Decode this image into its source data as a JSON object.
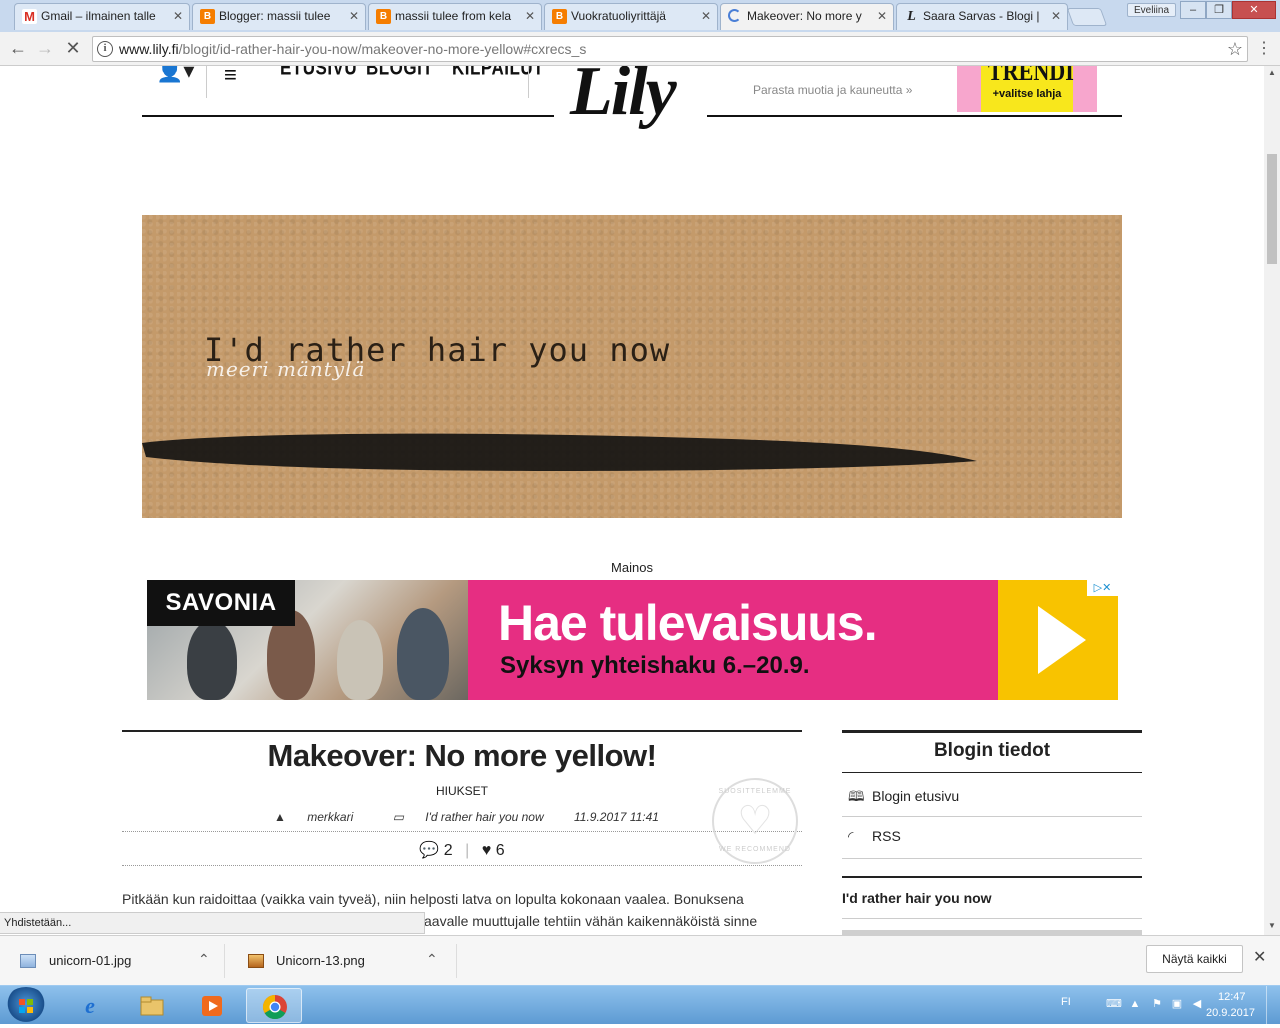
{
  "browser": {
    "tabs": [
      {
        "title": "Gmail – ilmainen talle",
        "favicon": "gmail-icon"
      },
      {
        "title": "Blogger: massii tulee",
        "favicon": "blogger-icon"
      },
      {
        "title": "massii tulee from kela",
        "favicon": "blogger-icon"
      },
      {
        "title": "Vuokratuoliyrittäjä",
        "favicon": "blogger-icon"
      },
      {
        "title": "Makeover: No more y",
        "favicon": "loading-icon",
        "active": true
      },
      {
        "title": "Saara Sarvas - Blogi |",
        "favicon": "lily-icon"
      }
    ],
    "profile_name": "Eveliina",
    "url_host": "www.lily.fi",
    "url_path": "/blogit/id-rather-hair-you-now/makeover-no-more-yellow#cxrecs_s",
    "status_text": "Yhdistetään..."
  },
  "site": {
    "nav": {
      "home": "ETUSIVU",
      "blogs": "BLOGIT",
      "contests": "KILPAILUT"
    },
    "logo": "Lily",
    "promo_text": "Parasta muotia ja kauneutta »",
    "promo_ad": {
      "title": "TRENDI",
      "subtitle": "+valitse lahja"
    }
  },
  "banner": {
    "title": "I'd rather hair you now",
    "subtitle": "meeri mäntylä"
  },
  "ad": {
    "label": "Mainos",
    "brand": "SAVONIA",
    "headline": "Hae tulevaisuus.",
    "subline": "Syksyn yhteishaku 6.–20.9.",
    "choices": "▷✕",
    "colors": {
      "pink": "#e62e82",
      "yellow": "#f8c300"
    }
  },
  "article": {
    "title": "Makeover: No more yellow!",
    "category": "HIUKSET",
    "author": "merkkari",
    "blog": "I'd rather hair you now",
    "date": "11.9.2017 11:41",
    "comments": "2",
    "likes": "6",
    "recommend_top": "SUOSITTELEMME",
    "recommend_bottom": "WE RECOMMEND",
    "body_line1": "Pitkään kun raidoittaa (vaikka vain tyveä), niin helposti latva on lopulta kokonaan vaalea. Bonuksena",
    "body_line2": "aavalle muuttujalle tehtiin vähän kaikennäköistä sinne"
  },
  "sidebar": {
    "title": "Blogin tiedot",
    "links": [
      {
        "label": "Blogin etusivu",
        "icon": "book-icon"
      },
      {
        "label": "RSS",
        "icon": "rss-icon"
      }
    ],
    "blog_name": "I'd rather hair you now"
  },
  "downloads": {
    "items": [
      {
        "name": "unicorn-01.jpg",
        "icon": "jpg-file-icon"
      },
      {
        "name": "Unicorn-13.png",
        "icon": "png-file-icon"
      }
    ],
    "show_all": "Näytä kaikki"
  },
  "taskbar": {
    "apps": [
      "internet-explorer-icon",
      "explorer-folder-icon",
      "media-player-icon",
      "chrome-icon"
    ],
    "language": "FI",
    "time": "12:47",
    "date": "20.9.2017"
  }
}
